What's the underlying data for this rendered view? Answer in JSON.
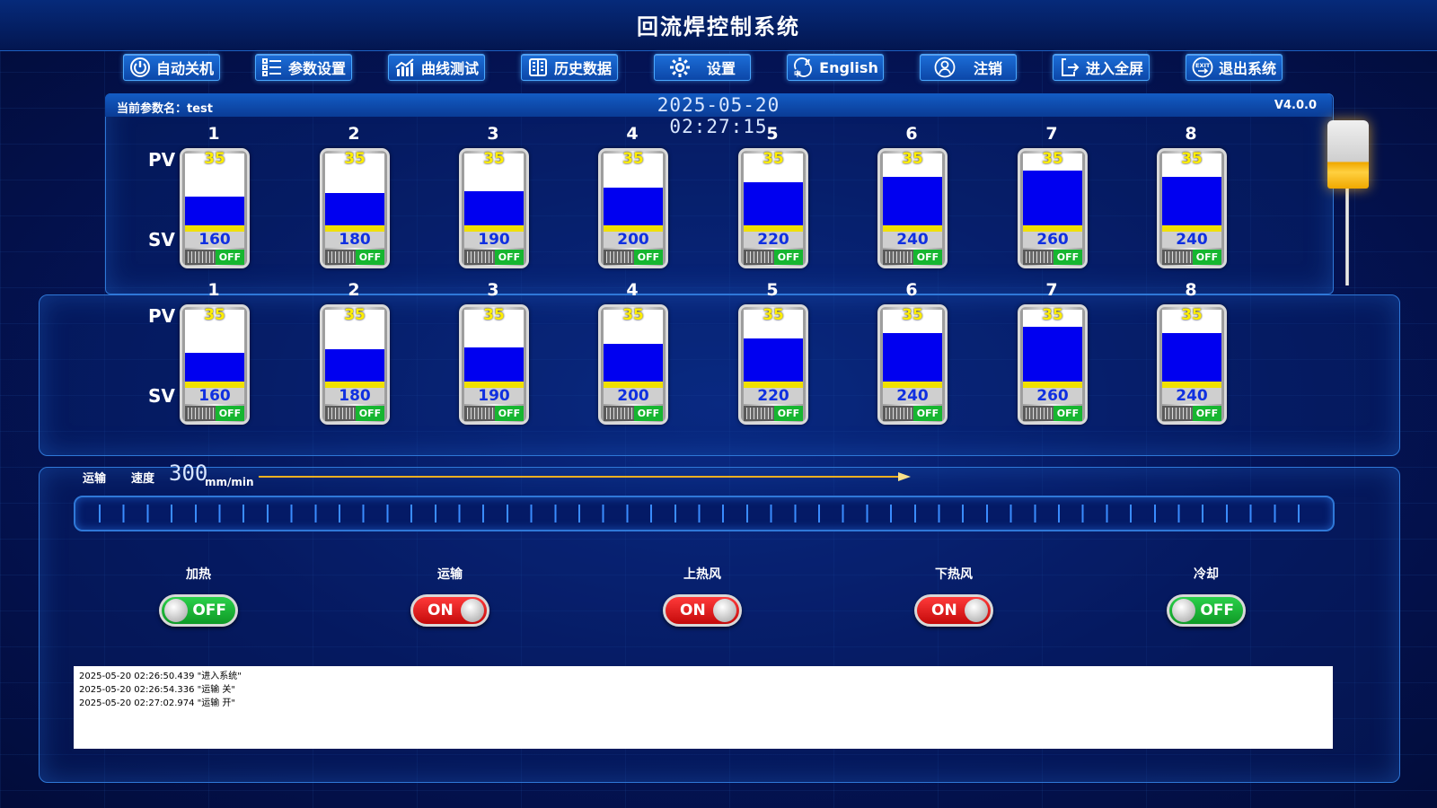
{
  "app": {
    "title": "回流焊控制系统",
    "param_prefix": "当前参数名：",
    "param_name": "test",
    "datetime": "2025-05-20 02:27:15",
    "version": "V4.0.0"
  },
  "toolbar": [
    {
      "label": "自动关机",
      "icon": "power-icon"
    },
    {
      "label": "参数设置",
      "icon": "list-icon"
    },
    {
      "label": "曲线测试",
      "icon": "chart-icon"
    },
    {
      "label": "历史数据",
      "icon": "book-icon"
    },
    {
      "label": "设置",
      "icon": "gear-icon"
    },
    {
      "label": "English",
      "icon": "language-icon"
    },
    {
      "label": "注销",
      "icon": "user-icon"
    },
    {
      "label": "进入全屏",
      "icon": "fullscreen-icon"
    },
    {
      "label": "退出系统",
      "icon": "exit-icon"
    }
  ],
  "labels": {
    "pv": "PV",
    "sv": "SV"
  },
  "zones_top": [
    {
      "num": "1",
      "pv": "35",
      "sv": "160",
      "fill": 0.4,
      "switch": "OFF"
    },
    {
      "num": "2",
      "pv": "35",
      "sv": "180",
      "fill": 0.45,
      "switch": "OFF"
    },
    {
      "num": "3",
      "pv": "35",
      "sv": "190",
      "fill": 0.48,
      "switch": "OFF"
    },
    {
      "num": "4",
      "pv": "35",
      "sv": "200",
      "fill": 0.52,
      "switch": "OFF"
    },
    {
      "num": "5",
      "pv": "35",
      "sv": "220",
      "fill": 0.6,
      "switch": "OFF"
    },
    {
      "num": "6",
      "pv": "35",
      "sv": "240",
      "fill": 0.68,
      "switch": "OFF"
    },
    {
      "num": "7",
      "pv": "35",
      "sv": "260",
      "fill": 0.76,
      "switch": "OFF"
    },
    {
      "num": "8",
      "pv": "35",
      "sv": "240",
      "fill": 0.68,
      "switch": "OFF"
    }
  ],
  "zones_bottom": [
    {
      "num": "1",
      "pv": "35",
      "sv": "160",
      "fill": 0.4,
      "switch": "OFF"
    },
    {
      "num": "2",
      "pv": "35",
      "sv": "180",
      "fill": 0.45,
      "switch": "OFF"
    },
    {
      "num": "3",
      "pv": "35",
      "sv": "190",
      "fill": 0.48,
      "switch": "OFF"
    },
    {
      "num": "4",
      "pv": "35",
      "sv": "200",
      "fill": 0.52,
      "switch": "OFF"
    },
    {
      "num": "5",
      "pv": "35",
      "sv": "220",
      "fill": 0.6,
      "switch": "OFF"
    },
    {
      "num": "6",
      "pv": "35",
      "sv": "240",
      "fill": 0.68,
      "switch": "OFF"
    },
    {
      "num": "7",
      "pv": "35",
      "sv": "260",
      "fill": 0.76,
      "switch": "OFF"
    },
    {
      "num": "8",
      "pv": "35",
      "sv": "240",
      "fill": 0.68,
      "switch": "OFF"
    }
  ],
  "conveyor": {
    "label": "运输",
    "speed_label": "速度",
    "speed": "300",
    "unit": "mm/min"
  },
  "toggles": [
    {
      "label": "加热",
      "state": "OFF"
    },
    {
      "label": "运输",
      "state": "ON"
    },
    {
      "label": "上热风",
      "state": "ON"
    },
    {
      "label": "下热风",
      "state": "ON"
    },
    {
      "label": "冷却",
      "state": "OFF"
    }
  ],
  "log": [
    "2025-05-20 02:26:50.439 \"进入系统\"",
    "2025-05-20 02:26:54.336 \"运输 关\"",
    "2025-05-20 02:27:02.974 \"运输 开\""
  ],
  "colors": {
    "accent": "#1c6ed8",
    "fill": "#0000f0",
    "pv_text": "#ffee00",
    "on": "#e01818",
    "off": "#16b630"
  }
}
